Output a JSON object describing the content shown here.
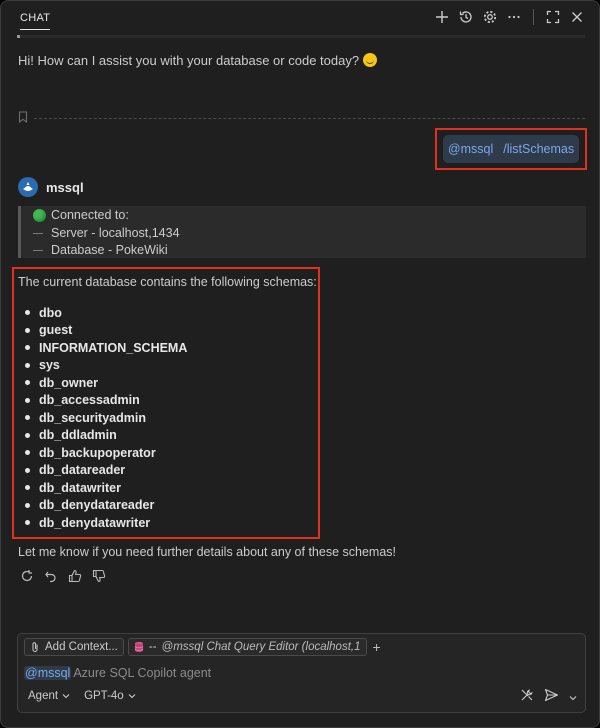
{
  "header": {
    "tab_label": "CHAT",
    "icons": [
      "plus-icon",
      "history-icon",
      "gear-icon",
      "ellipsis-icon",
      "maximize-icon",
      "close-icon"
    ]
  },
  "greeting": {
    "text": "Hi! How can I assist you with your database or code today?"
  },
  "user_message": {
    "mention": "@mssql",
    "command": "/listSchemas"
  },
  "agent": {
    "name": "mssql",
    "connection": {
      "title": "Connected to:",
      "server": "Server - localhost,1434",
      "database": "Database - PokeWiki"
    },
    "intro": "The current database contains the following schemas:",
    "schemas": [
      "dbo",
      "guest",
      "INFORMATION_SCHEMA",
      "sys",
      "db_owner",
      "db_accessadmin",
      "db_securityadmin",
      "db_ddladmin",
      "db_backupoperator",
      "db_datareader",
      "db_datawriter",
      "db_denydatareader",
      "db_denydatawriter"
    ],
    "closing": "Let me know if you need further details about any of these schemas!"
  },
  "input": {
    "add_context_label": "Add Context...",
    "context_chip_prefix": "--",
    "context_chip_label": "@mssql Chat Query Editor (localhost,1",
    "mention": "@mssql",
    "placeholder": "Azure SQL Copilot agent",
    "mode": "Agent",
    "model": "GPT-4o"
  },
  "colors": {
    "accent": "#7aa9e8",
    "highlight_border": "#e0301e",
    "connected": "#3fb950"
  }
}
